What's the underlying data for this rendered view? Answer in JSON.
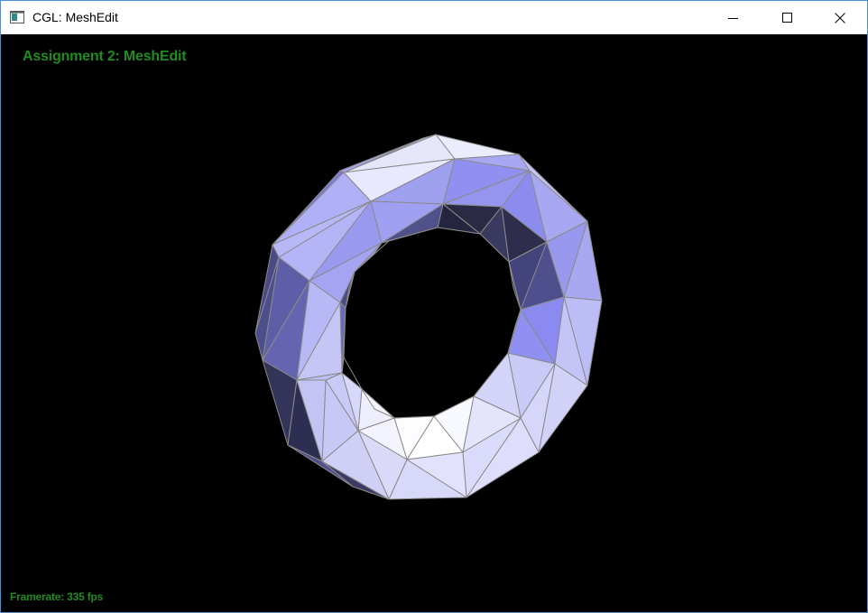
{
  "window": {
    "title": "CGL: MeshEdit"
  },
  "viewport": {
    "heading": "Assignment 2: MeshEdit",
    "framerate": "Framerate: 335 fps"
  },
  "colors": {
    "background": "#000000",
    "overlay_text": "#228b22",
    "mesh_edge": "#808080"
  },
  "icons": {
    "app": "app-window-icon",
    "minimize": "minimize-icon",
    "maximize": "maximize-icon",
    "close": "close-icon"
  }
}
